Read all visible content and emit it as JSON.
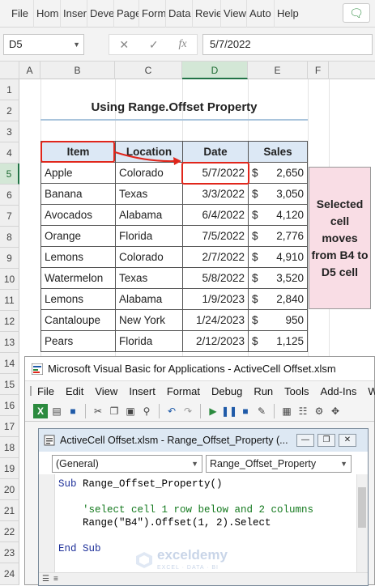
{
  "menu": [
    "File",
    "Hom",
    "Inser",
    "Deve",
    "Page",
    "Form",
    "Data",
    "Revie",
    "View",
    "Auto",
    "Help"
  ],
  "formula": {
    "namebox": "D5",
    "fx": "fx",
    "cancel": "✕",
    "confirm": "✓",
    "value": "5/7/2022"
  },
  "columns": [
    "A",
    "B",
    "C",
    "D",
    "E",
    "F"
  ],
  "rows": [
    "1",
    "2",
    "3",
    "4",
    "5",
    "6",
    "7",
    "8",
    "9",
    "10",
    "11",
    "12",
    "13",
    "14",
    "15",
    "16",
    "17",
    "18",
    "19",
    "20",
    "21",
    "22",
    "23",
    "24"
  ],
  "title": "Using Range.Offset Property",
  "table": {
    "headers": [
      "Item",
      "Location",
      "Date",
      "Sales"
    ],
    "rows": [
      {
        "item": "Apple",
        "location": "Colorado",
        "date": "5/7/2022",
        "currency": "$",
        "sales": "2,650"
      },
      {
        "item": "Banana",
        "location": "Texas",
        "date": "3/3/2022",
        "currency": "$",
        "sales": "3,050"
      },
      {
        "item": "Avocados",
        "location": "Alabama",
        "date": "6/4/2022",
        "currency": "$",
        "sales": "4,120"
      },
      {
        "item": "Orange",
        "location": "Florida",
        "date": "7/5/2022",
        "currency": "$",
        "sales": "2,776"
      },
      {
        "item": "Lemons",
        "location": "Colorado",
        "date": "2/7/2022",
        "currency": "$",
        "sales": "4,910"
      },
      {
        "item": "Watermelon",
        "location": "Texas",
        "date": "5/8/2022",
        "currency": "$",
        "sales": "3,520"
      },
      {
        "item": "Lemons",
        "location": "Alabama",
        "date": "1/9/2023",
        "currency": "$",
        "sales": "2,840"
      },
      {
        "item": "Cantaloupe",
        "location": "New York",
        "date": "1/24/2023",
        "currency": "$",
        "sales": "950"
      },
      {
        "item": "Pears",
        "location": "Florida",
        "date": "2/12/2023",
        "currency": "$",
        "sales": "1,125"
      }
    ]
  },
  "note": "Selected cell moves from B4 to D5 cell",
  "vba": {
    "title": "Microsoft Visual Basic for Applications - ActiveCell Offset.xlsm",
    "menu": [
      "File",
      "Edit",
      "View",
      "Insert",
      "Format",
      "Debug",
      "Run",
      "Tools",
      "Add-Ins",
      "W"
    ],
    "code_window_title": "ActiveCell Offset.xlsm - Range_Offset_Property (...",
    "object_combo": "(General)",
    "proc_combo": "Range_Offset_Property",
    "code": {
      "line1_kw": "Sub",
      "line1_rest": " Range_Offset_Property()",
      "line2": "'select cell 1 row below and 2 columns",
      "line3": "Range(\"B4\").Offset(1, 2).Select",
      "line4": "End Sub"
    }
  },
  "watermark": {
    "name": "exceldemy",
    "tagline": "EXCEL · DATA · BI"
  }
}
